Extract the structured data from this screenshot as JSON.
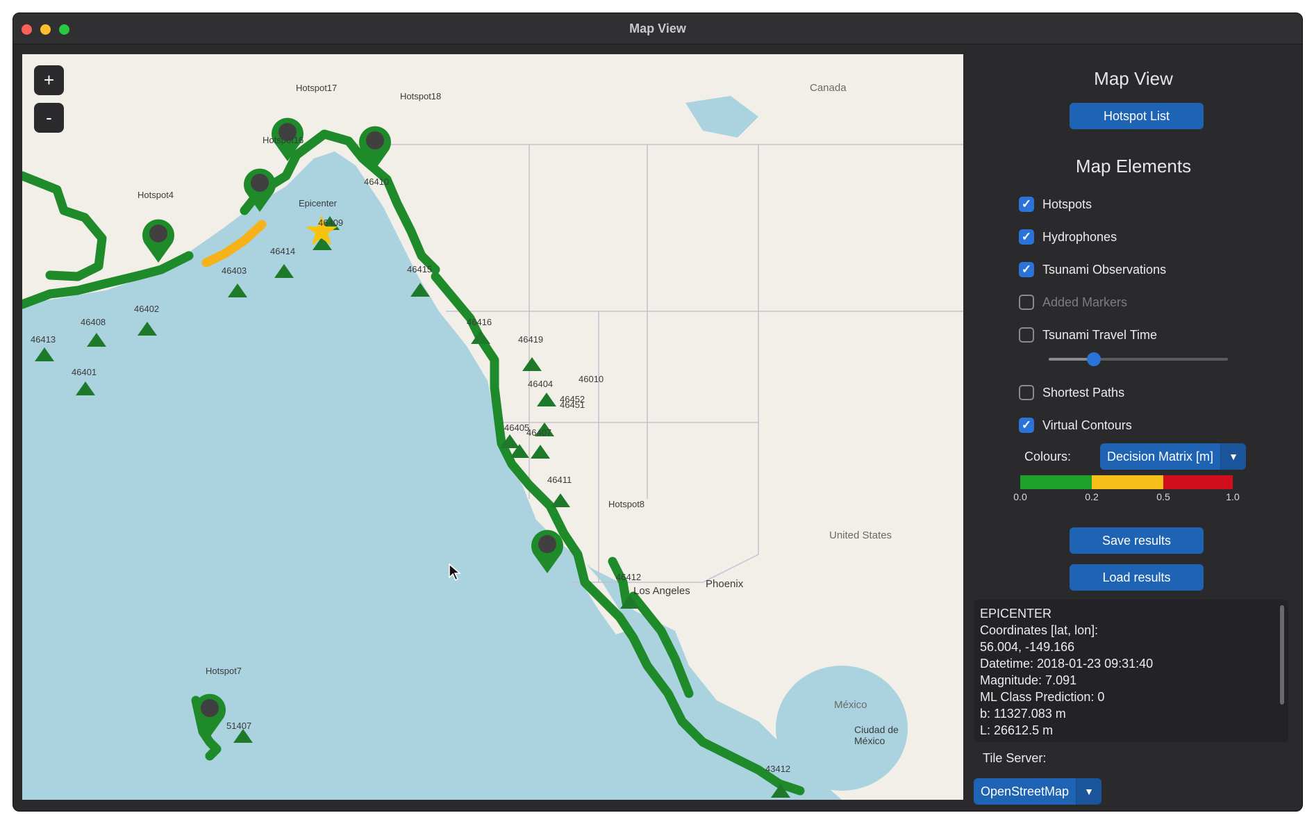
{
  "window": {
    "title": "Map View"
  },
  "map": {
    "zoom_in_label": "+",
    "zoom_out_label": "-",
    "country_labels": [
      "Canada",
      "United States",
      "México",
      "Ciudad de México"
    ],
    "city_labels": [
      "Phoenix",
      "Los Angeles"
    ],
    "epicenter_label": "Epicenter",
    "hotspots": [
      "Hotspot4",
      "Hotspot16",
      "Hotspot17",
      "Hotspot18",
      "Hotspot8",
      "Hotspot7"
    ],
    "stations": [
      "46413",
      "46408",
      "46401",
      "46402",
      "46403",
      "46414",
      "46409",
      "46410",
      "46415",
      "46416",
      "46419",
      "46404",
      "46010",
      "46452",
      "46451",
      "46405",
      "46407",
      "46411",
      "46412",
      "51407",
      "43412"
    ]
  },
  "panel": {
    "title": "Map View",
    "hotspot_list_button": "Hotspot List",
    "elements_title": "Map Elements",
    "checkboxes": [
      {
        "label": "Hotspots",
        "checked": true
      },
      {
        "label": "Hydrophones",
        "checked": true
      },
      {
        "label": "Tsunami Observations",
        "checked": true
      },
      {
        "label": "Added Markers",
        "checked": false
      },
      {
        "label": "Tsunami Travel Time",
        "checked": false
      },
      {
        "label": "Shortest Paths",
        "checked": false
      },
      {
        "label": "Virtual Contours",
        "checked": true
      }
    ],
    "travel_time_slider": 0.25,
    "colours_label": "Colours:",
    "colours_value": "Decision Matrix [m]",
    "colour_scale": {
      "ticks": [
        "0.0",
        "0.2",
        "0.5",
        "1.0"
      ],
      "colors": [
        "#1ea12a",
        "#f6bf1a",
        "#d10f1c"
      ]
    },
    "save_button": "Save results",
    "load_button": "Load results",
    "info": {
      "heading": "EPICENTER",
      "coords_label": "Coordinates [lat, lon]:",
      "coords": "56.004, -149.166",
      "datetime": "Datetime: 2018-01-23 09:31:40",
      "magnitude": "Magnitude: 7.091",
      "ml_class": "ML Class Prediction: 0",
      "b": "b: 11327.083 m",
      "L": "L: 26612.5 m"
    },
    "tile_server_label": "Tile Server:",
    "tile_server_value": "OpenStreetMap"
  },
  "colors": {
    "contour_green": "#1e8a2a",
    "contour_yellow": "#f6b21a",
    "accent_blue": "#1f63b4",
    "ocean": "#aad3df",
    "land": "#f2efe9"
  }
}
